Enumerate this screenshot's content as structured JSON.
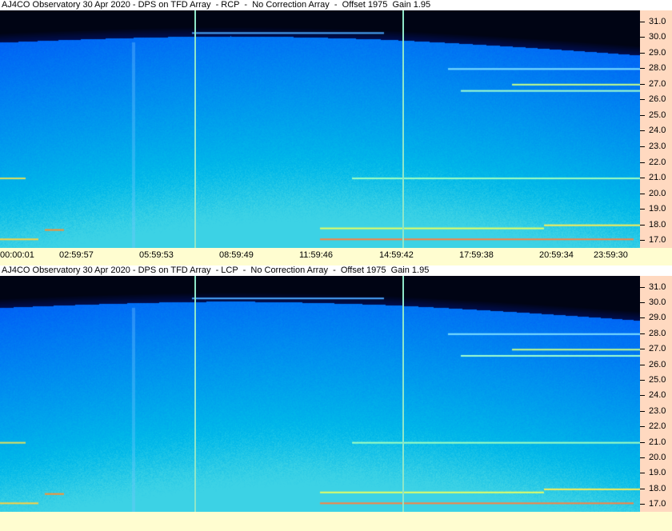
{
  "chart_data": [
    {
      "type": "heatmap",
      "title": "AJ4CO Observatory 30 Apr 2020 - DPS on TFD Array  - RCP  -  No Correction Array  -  Offset 1975  Gain 1.95",
      "x_tick_labels": [
        "00:00:01",
        "02:59:57",
        "05:59:53",
        "08:59:49",
        "11:59:46",
        "14:59:42",
        "17:59:38",
        "20:59:34",
        "23:59:30"
      ],
      "y_tick_labels": [
        "31.0",
        "30.0",
        "29.0",
        "28.0",
        "27.0",
        "26.0",
        "25.0",
        "24.0",
        "23.0",
        "22.0",
        "21.0",
        "20.0",
        "19.0",
        "18.0",
        "17.0"
      ],
      "ylim": [
        16.5,
        31.7
      ],
      "markers_x": [
        "07:18",
        "15:06"
      ]
    },
    {
      "type": "heatmap",
      "title": "AJ4CO Observatory 30 Apr 2020 - DPS on TFD Array  - LCP  -  No Correction Array  -  Offset 1975  Gain 1.95",
      "y_tick_labels": [
        "31.0",
        "30.0",
        "29.0",
        "28.0",
        "27.0",
        "26.0",
        "25.0",
        "24.0",
        "23.0",
        "22.0",
        "21.0",
        "20.0",
        "19.0",
        "18.0",
        "17.0"
      ],
      "ylim": [
        16.5,
        31.7
      ],
      "markers_x": [
        "07:18",
        "15:06"
      ]
    }
  ]
}
